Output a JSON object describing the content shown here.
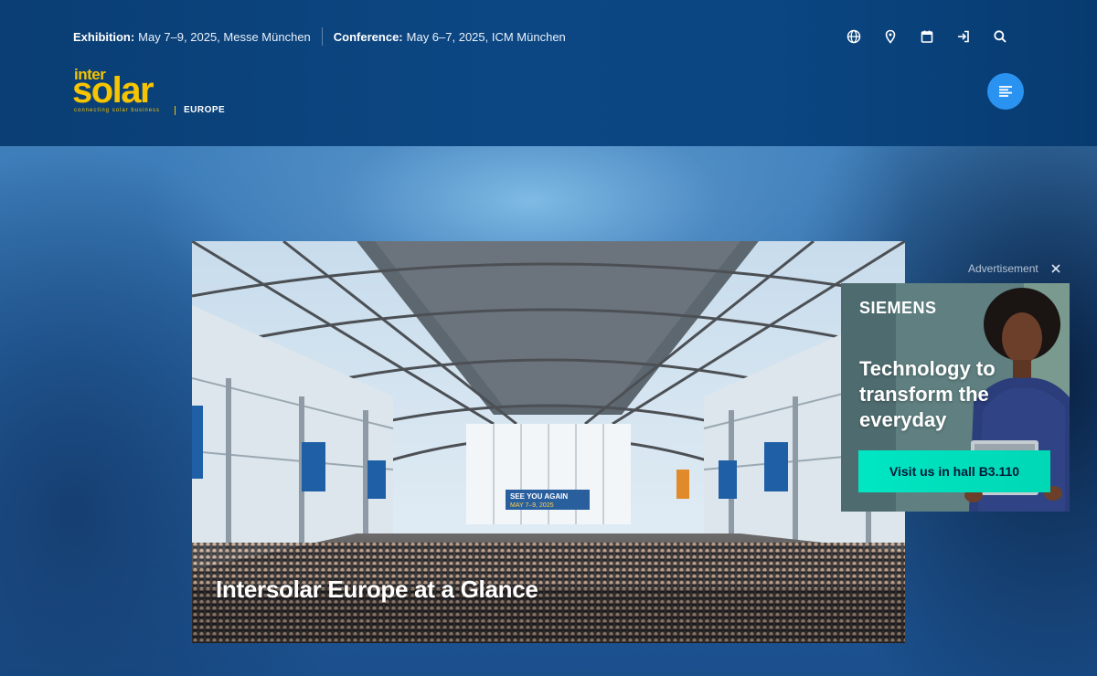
{
  "header": {
    "exhibition_label": "Exhibition:",
    "exhibition_text": "May 7–9, 2025, Messe München",
    "conference_label": "Conference:",
    "conference_text": "May 6–7, 2025, ICM München",
    "icons": [
      "globe-icon",
      "location-pin-icon",
      "calendar-icon",
      "login-icon",
      "search-icon"
    ],
    "logo": {
      "top": "inter",
      "main": "solar",
      "tagline": "connecting solar business",
      "region": "EUROPE"
    },
    "menu_icon": "menu-icon"
  },
  "hero": {
    "caption": "Intersolar Europe at a Glance",
    "photo_signage": "SEE YOU AGAIN",
    "photo_signage_date": "MAY 7–9, 2025"
  },
  "ad": {
    "label": "Advertisement",
    "brand": "SIEMENS",
    "headline": "Technology to transform the everyday",
    "cta": "Visit us in hall B3.110"
  },
  "colors": {
    "header_bg": "#0b4682",
    "logo_yellow": "#f6c400",
    "menu_button": "#2a93f2",
    "ad_cta": "#00e6c3"
  }
}
